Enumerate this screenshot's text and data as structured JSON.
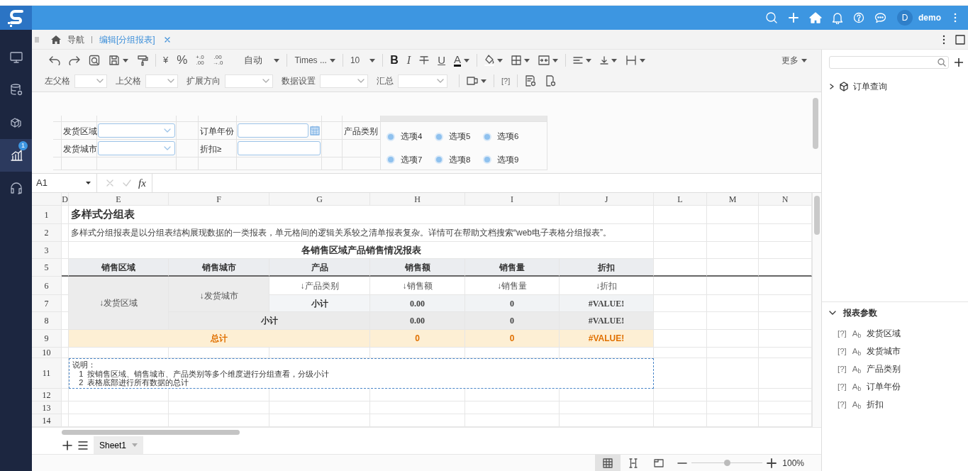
{
  "header": {
    "user": {
      "initial": "D",
      "name": "demo"
    }
  },
  "sidebar": {
    "items": [
      {
        "selected": false
      },
      {
        "selected": false
      },
      {
        "selected": false
      },
      {
        "selected": true,
        "badge": "1"
      },
      {
        "selected": false
      }
    ]
  },
  "tabs": [
    {
      "label": "导航",
      "selected": false,
      "kind": "home",
      "closable": false
    },
    {
      "label": "编辑[分组报表]",
      "selected": true,
      "kind": "document",
      "closable": true
    }
  ],
  "toolbar": {
    "currency": "¥",
    "percent": "%",
    "decimals": [
      [
        "+.0",
        ".00"
      ],
      [
        ".00",
        "→.0"
      ]
    ],
    "number_format": "自动",
    "font": "Times ...",
    "font_size": "10",
    "bold": "B",
    "italic": "I",
    "underline": "U",
    "font_color": "A",
    "more": "更多",
    "help_tag": "[?]",
    "cell_settings": [
      {
        "label": "左父格"
      },
      {
        "label": "上父格"
      },
      {
        "label": "扩展方向"
      },
      {
        "label": "数据设置"
      },
      {
        "label": "汇总"
      }
    ]
  },
  "param_form": {
    "fields": [
      {
        "label": "发货区域",
        "kind": "select"
      },
      {
        "label": "发货城市",
        "kind": "select"
      },
      {
        "label": "订单年份",
        "kind": "date"
      },
      {
        "label": "折扣≥",
        "kind": "text"
      },
      {
        "label": "产品类别",
        "kind": "radio",
        "options": [
          {
            "label": "选项4",
            "selected": false
          },
          {
            "label": "选项5",
            "selected": false
          },
          {
            "label": "选项6",
            "selected": false
          },
          {
            "label": "选项7",
            "selected": false
          },
          {
            "label": "选项8",
            "selected": false
          },
          {
            "label": "选项9",
            "selected": false
          }
        ]
      }
    ]
  },
  "formula_bar": {
    "cell_ref": "A1",
    "fx": "fx"
  },
  "sheet": {
    "columns": [
      "D",
      "E",
      "F",
      "G",
      "H",
      "I",
      "J",
      "L",
      "M",
      "N"
    ],
    "rows": [
      {
        "number": "1",
        "cells": [
          {
            "text": ""
          },
          {
            "text": "多样式分组表",
            "kind": "title",
            "colspan": 6
          }
        ]
      },
      {
        "number": "2",
        "cells": [
          {
            "text": ""
          },
          {
            "text": "多样式分组报表是以分组表结构展现数据的一类报表，单元格间的逻辑关系较之清单报表复杂。详情可在帮助文档搜索“web电子表格分组报表”。",
            "kind": "text",
            "colspan": 6
          }
        ]
      },
      {
        "number": "3",
        "cells": [
          {
            "text": ""
          },
          {
            "text": "各销售区域产品销售情况报表",
            "kind": "caption",
            "colspan": 6
          }
        ]
      },
      {
        "number": "5",
        "cells": [
          {
            "text": ""
          },
          {
            "text": "销售区域",
            "kind": "header"
          },
          {
            "text": "销售城市",
            "kind": "header"
          },
          {
            "text": "产品",
            "kind": "header"
          },
          {
            "text": "销售额",
            "kind": "header"
          },
          {
            "text": "销售量",
            "kind": "header"
          },
          {
            "text": "折扣",
            "kind": "header"
          }
        ]
      },
      {
        "number": "6",
        "cells": [
          {
            "text": ""
          },
          {
            "text": "↓发货区域",
            "kind": "group",
            "rowspan": 3
          },
          {
            "text": "↓发货城市",
            "kind": "group",
            "rowspan": 2
          },
          {
            "text": "↓产品类别",
            "kind": "field"
          },
          {
            "text": "↓销售额",
            "kind": "field"
          },
          {
            "text": "↓销售量",
            "kind": "field"
          },
          {
            "text": "↓折扣",
            "kind": "field"
          }
        ]
      },
      {
        "number": "7",
        "cells": [
          {
            "text": ""
          },
          {
            "text": "小计",
            "kind": "subtotal"
          },
          {
            "text": "0.00",
            "kind": "number"
          },
          {
            "text": "0",
            "kind": "number"
          },
          {
            "text": "#VALUE!",
            "kind": "number"
          }
        ]
      },
      {
        "number": "8",
        "cells": [
          {
            "text": ""
          },
          {
            "text": "小计",
            "kind": "group-total",
            "colspan": 2
          },
          {
            "text": "0.00",
            "kind": "group-number"
          },
          {
            "text": "0",
            "kind": "group-number"
          },
          {
            "text": "#VALUE!",
            "kind": "group-number"
          }
        ]
      },
      {
        "number": "9",
        "cells": [
          {
            "text": ""
          },
          {
            "text": "总计",
            "kind": "total",
            "colspan": 3
          },
          {
            "text": "0",
            "kind": "total"
          },
          {
            "text": "0",
            "kind": "total"
          },
          {
            "text": "#VALUE!",
            "kind": "total"
          }
        ]
      },
      {
        "number": "10",
        "cells": []
      },
      {
        "number": "11",
        "cells": [
          {
            "text": ""
          },
          {
            "text": "说明：\n   1  按销售区域、销售城市、产品类别等多个维度进行分组查看，分级小计\n   2  表格底部进行所有数据的总计",
            "kind": "note",
            "colspan": 6
          }
        ]
      },
      {
        "number": "12",
        "cells": []
      },
      {
        "number": "13",
        "cells": []
      },
      {
        "number": "14",
        "cells": []
      }
    ]
  },
  "sheet_tabs": [
    {
      "label": "Sheet1",
      "selected": true
    }
  ],
  "status_bar": {
    "views": [
      {
        "selected": true
      },
      {
        "selected": false
      },
      {
        "selected": false
      }
    ],
    "zoom": {
      "level": 0.5,
      "reading": "100%"
    }
  },
  "right_panel": {
    "datasets": [
      {
        "label": "订单查询",
        "expanded": false
      }
    ],
    "params": {
      "title": "报表参数",
      "expanded": true,
      "items": [
        {
          "tag": "[?]",
          "type": "A$_{b}$",
          "label": "发货区域"
        },
        {
          "tag": "[?]",
          "type": "A$_{b}$",
          "label": "发货城市"
        },
        {
          "tag": "[?]",
          "type": "A$_{b}$",
          "label": "产品类别"
        },
        {
          "tag": "[?]",
          "type": "A$_{b}$",
          "label": "订单年份"
        },
        {
          "tag": "[?]",
          "type": "A$_{b}$",
          "label": "折扣"
        }
      ]
    }
  }
}
